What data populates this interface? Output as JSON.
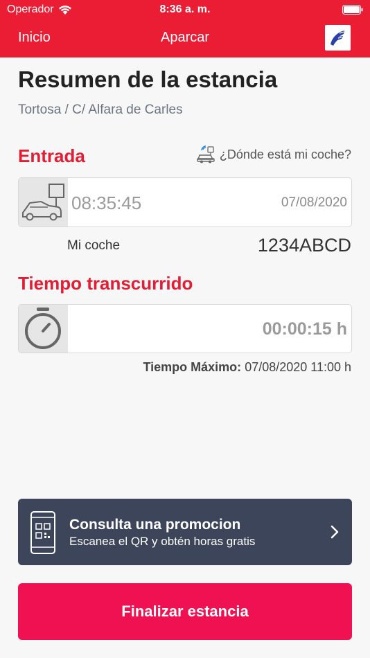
{
  "status_bar": {
    "carrier": "Operador",
    "time": "8:36 a. m."
  },
  "nav": {
    "back_label": "Inicio",
    "title": "Aparcar"
  },
  "summary": {
    "title": "Resumen de la estancia",
    "location": "Tortosa / C/ Alfara de Carles"
  },
  "entry": {
    "section_label": "Entrada",
    "where_link": "¿Dónde está mi coche?",
    "time": "08:35:45",
    "date": "07/08/2020",
    "car_label": "Mi coche",
    "plate": "1234ABCD"
  },
  "elapsed": {
    "section_label": "Tiempo transcurrido",
    "value": "00:00:15 h",
    "max_label": "Tiempo Máximo:",
    "max_value": "07/08/2020 11:00 h"
  },
  "promo": {
    "title": "Consulta una promocion",
    "subtitle": "Escanea el QR y obtén horas gratis"
  },
  "actions": {
    "finish_label": "Finalizar estancia"
  },
  "colors": {
    "brand_red": "#ea1d34",
    "section_red": "#e41d34",
    "promo_bg": "#3c455a",
    "finish_button": "#f01152"
  }
}
